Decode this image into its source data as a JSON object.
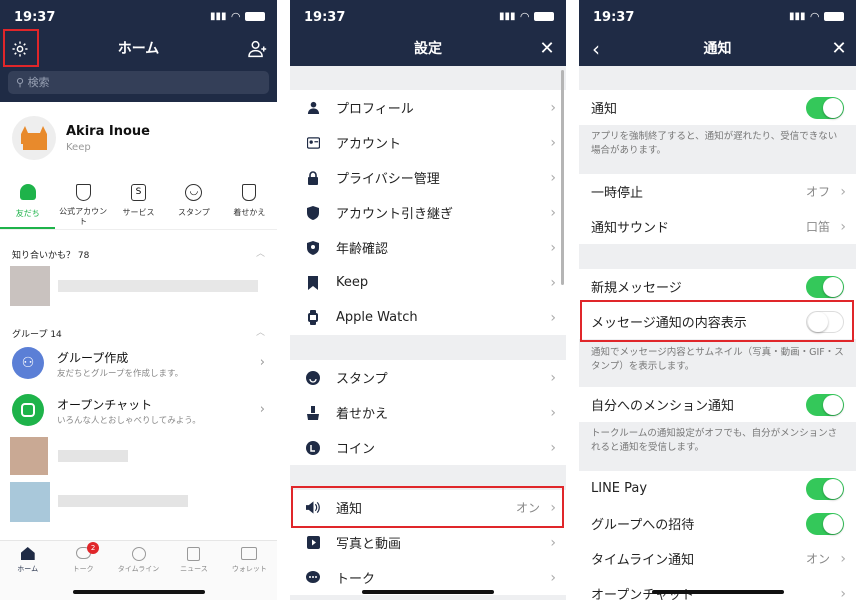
{
  "status_time": "19:37",
  "home": {
    "title": "ホーム",
    "search_placeholder": "検索",
    "profile_name": "Akira Inoue",
    "profile_sub": "Keep",
    "quick": [
      {
        "label": "友だち"
      },
      {
        "label": "公式アカウント"
      },
      {
        "label": "サービス"
      },
      {
        "label": "スタンプ"
      },
      {
        "label": "着せかえ"
      }
    ],
    "suggest_title": "知り合いかも？ 78",
    "group_title": "グループ 14",
    "group_create": "グループ作成",
    "group_create_sub": "友だちとグループを作成します。",
    "openchat": "オープンチャット",
    "openchat_sub": "いろんな人とおしゃべりしてみよう。",
    "tabs": [
      {
        "label": "ホーム"
      },
      {
        "label": "トーク",
        "badge": "2"
      },
      {
        "label": "タイムライン"
      },
      {
        "label": "ニュース"
      },
      {
        "label": "ウォレット"
      }
    ]
  },
  "settings": {
    "title": "設定",
    "items1": [
      {
        "label": "プロフィール",
        "icon": "person-icon"
      },
      {
        "label": "アカウント",
        "icon": "id-card-icon"
      },
      {
        "label": "プライバシー管理",
        "icon": "lock-icon"
      },
      {
        "label": "アカウント引き継ぎ",
        "icon": "shield-icon"
      },
      {
        "label": "年齢確認",
        "icon": "badge-icon"
      },
      {
        "label": "Keep",
        "icon": "bookmark-icon"
      },
      {
        "label": "Apple Watch",
        "icon": "watch-icon"
      }
    ],
    "items2": [
      {
        "label": "スタンプ",
        "icon": "smiley-icon"
      },
      {
        "label": "着せかえ",
        "icon": "brush-icon"
      },
      {
        "label": "コイン",
        "icon": "coin-icon"
      }
    ],
    "items3": [
      {
        "label": "通知",
        "value": "オン",
        "icon": "speaker-icon"
      },
      {
        "label": "写真と動画",
        "icon": "play-icon"
      },
      {
        "label": "トーク",
        "icon": "chat-icon"
      }
    ]
  },
  "notify": {
    "title": "通知",
    "notify_label": "通知",
    "notify_note": "アプリを強制終了すると、通知が遅れたり、受信できない場合があります。",
    "pause_label": "一時停止",
    "pause_value": "オフ",
    "sound_label": "通知サウンド",
    "sound_value": "口笛",
    "new_msg_label": "新規メッセージ",
    "preview_label": "メッセージ通知の内容表示",
    "preview_note": "通知でメッセージ内容とサムネイル（写真・動画・GIF・スタンプ）を表示します。",
    "mention_label": "自分へのメンション通知",
    "mention_note": "トークルームの通知設定がオフでも、自分がメンションされると通知を受信します。",
    "linepay_label": "LINE Pay",
    "group_invite_label": "グループへの招待",
    "timeline_label": "タイムライン通知",
    "timeline_value": "オン",
    "openchat_label": "オープンチャット"
  },
  "colors": {
    "navy": "#1f2b45",
    "green": "#34c85a",
    "line_green": "#1eb34a",
    "red": "#e0262a"
  }
}
